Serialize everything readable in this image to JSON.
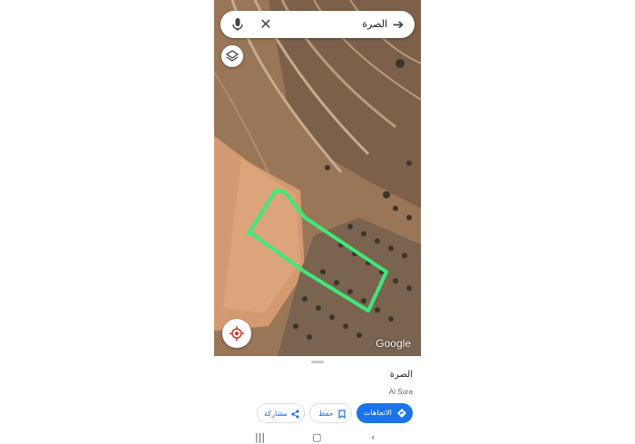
{
  "search": {
    "query": "الصرة",
    "mic_icon": "microphone-icon",
    "clear_icon": "close-icon",
    "back_icon": "arrow-back-icon"
  },
  "map": {
    "logo": "Google",
    "layers_icon": "layers-icon",
    "locate_icon": "my-location-icon",
    "outline_color": "#3ee87a",
    "satellite_base_color": "#a07d5e"
  },
  "place": {
    "title": "الصرة",
    "subtitle": "Al Sura"
  },
  "actions": {
    "share_label": "مشاركة",
    "save_label": "حفظ",
    "directions_label": "الاتجاهات",
    "primary_color": "#1a73e8"
  },
  "navbar": {
    "recents_icon": "recents-icon",
    "home_icon": "home-icon",
    "back_icon": "back-chevron-icon"
  }
}
